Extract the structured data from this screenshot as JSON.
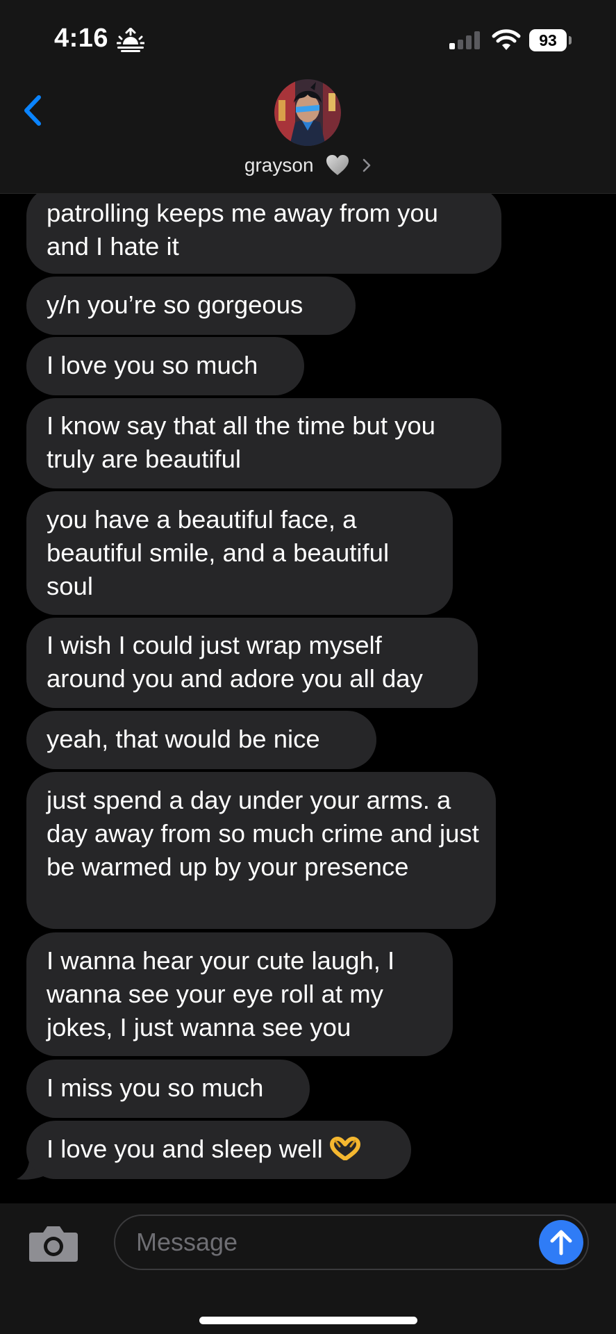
{
  "status_bar": {
    "time": "4:16",
    "battery_level": "93",
    "time_icon": "sunrise-icon",
    "signal_bars_active": 1,
    "signal_bars_total": 4
  },
  "header": {
    "back_icon": "chevron-left-icon",
    "contact_name": "grayson",
    "heart_emoji": "white-heart",
    "chevron": "chevron-right-icon",
    "accent_color": "#0a84ff"
  },
  "messages": [
    {
      "text": "patrolling keeps me away from you and I hate it"
    },
    {
      "text": "y/n you’re so gorgeous"
    },
    {
      "text": "I love you so much"
    },
    {
      "text": "I know say that all the time but you truly are beautiful"
    },
    {
      "text": "you have a beautiful face, a beautiful smile, and a beautiful soul"
    },
    {
      "text": "I wish I could just wrap myself around you and adore you all day"
    },
    {
      "text": "yeah, that would be nice"
    },
    {
      "text": "just spend a day under your arms. a day away from so much crime and just be warmed up by your presence"
    },
    {
      "text": "I wanna hear your cute laugh, I wanna see your eye roll at my jokes, I just wanna see you"
    },
    {
      "text": "I miss you so much"
    },
    {
      "text": "I love you and sleep well",
      "emoji": "heart-hands"
    }
  ],
  "composer": {
    "placeholder": "Message",
    "camera_icon": "camera-icon",
    "send_icon": "arrow-up-icon",
    "send_color": "#2f7cf6"
  },
  "colors": {
    "bubble": "#262628",
    "background": "#000000",
    "bars": "#161616"
  }
}
